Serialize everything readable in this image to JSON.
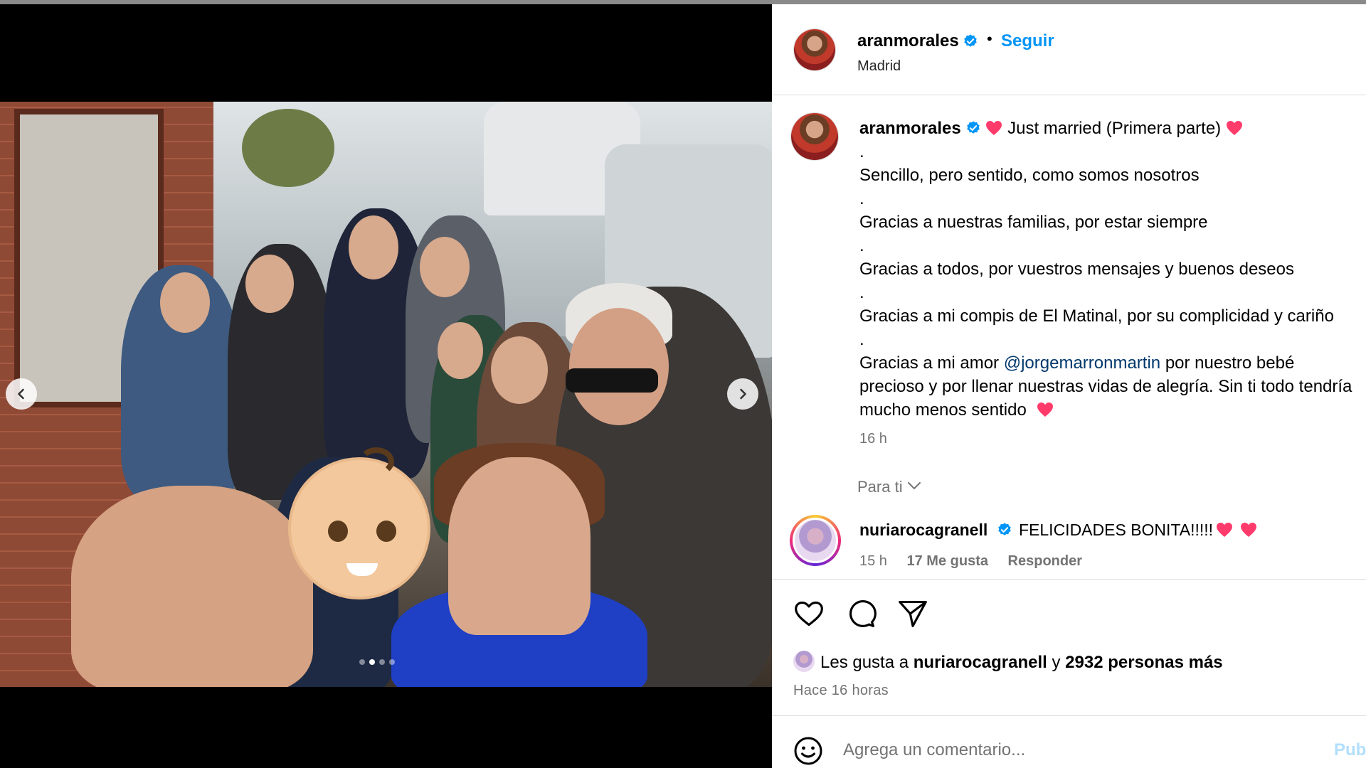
{
  "post": {
    "username": "aranmorales",
    "follow_label": "Seguir",
    "bullet": "•",
    "location": "Madrid"
  },
  "caption": {
    "username": "aranmorales",
    "line1_text": "Just married (Primera parte)",
    "dot1": ".",
    "line2": "Sencillo, pero sentido, como somos nosotros",
    "dot2": ".",
    "line3": "Gracias a nuestras familias, por estar siempre",
    "dot3": ".",
    "line4": "Gracias a todos, por vuestros mensajes y buenos deseos",
    "dot4": ".",
    "line5": "Gracias a mi compis de El Matinal, por su complicidad y cariño",
    "dot5": ".",
    "line6_prefix": "Gracias a mi amor ",
    "line6_mention": "@jorgemarronmartin",
    "line6_suffix": " por nuestro bebé",
    "line7": "precioso y por llenar nuestras vidas de alegría. Sin ti todo tendría",
    "line8": "mucho menos sentido",
    "time": "16 h"
  },
  "for_you": {
    "label": "Para ti"
  },
  "comment": {
    "username": "nuriarocagranell",
    "text": "FELICIDADES BONITA!!!!!",
    "time": "15 h",
    "likes": "17 Me gusta",
    "reply": "Responder"
  },
  "likes": {
    "prefix": "Les gusta a",
    "user": "nuriarocagranell",
    "connector": "y",
    "others": "2932 personas más",
    "ago": "Hace 16 horas"
  },
  "add_comment": {
    "placeholder": "Agrega un comentario...",
    "publish": "Publicar"
  },
  "carousel": {
    "total_slides": 4,
    "current_slide": 2
  },
  "colors": {
    "accent": "#0095f6",
    "mention": "#00376b",
    "heart": "#ff3b6b",
    "muted": "#737373"
  },
  "icons": [
    "chevron-left-icon",
    "chevron-right-icon",
    "verified-icon",
    "heart-icon",
    "comment-icon",
    "share-icon",
    "emoji-icon",
    "chevron-down-icon"
  ]
}
